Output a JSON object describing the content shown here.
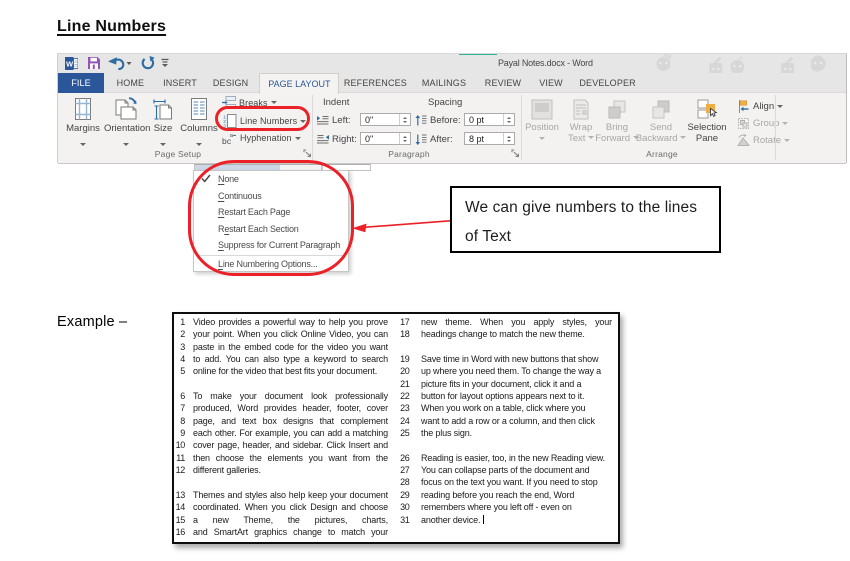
{
  "doc": {
    "heading": "Line Numbers",
    "example_label": "Example –"
  },
  "annotations": {
    "red_color": "#ec2027",
    "callout_text": "We can give numbers to the lines of Text"
  },
  "word": {
    "titlebar": {
      "title": "Payal Notes.docx - Word",
      "qat_icons": [
        "word-app-icon",
        "save-icon",
        "undo-icon",
        "repeat-icon",
        "customize-qat-icon"
      ]
    },
    "tabs": [
      {
        "label": "FILE",
        "kind": "file"
      },
      {
        "label": "HOME",
        "kind": ""
      },
      {
        "label": "INSERT",
        "kind": ""
      },
      {
        "label": "DESIGN",
        "kind": ""
      },
      {
        "label": "PAGE LAYOUT",
        "kind": "active"
      },
      {
        "label": "REFERENCES",
        "kind": ""
      },
      {
        "label": "MAILINGS",
        "kind": ""
      },
      {
        "label": "REVIEW",
        "kind": ""
      },
      {
        "label": "VIEW",
        "kind": ""
      },
      {
        "label": "DEVELOPER",
        "kind": ""
      }
    ],
    "ribbon": {
      "page_setup": {
        "label": "Page Setup",
        "margins": "Margins",
        "orientation": "Orientation",
        "size": "Size",
        "columns": "Columns",
        "breaks": "Breaks",
        "line_numbers": "Line Numbers",
        "hyphenation": "Hyphenation"
      },
      "paragraph": {
        "label": "Paragraph",
        "indent_header": "Indent",
        "spacing_header": "Spacing",
        "left_label": "Left:",
        "left_value": "0\"",
        "right_label": "Right:",
        "right_value": "0\"",
        "before_label": "Before:",
        "before_value": "0 pt",
        "after_label": "After:",
        "after_value": "8 pt"
      },
      "arrange": {
        "label": "Arrange",
        "position": "Position",
        "wrap1": "Wrap",
        "wrap2": "Text",
        "bring1": "Bring",
        "bring2": "Forward",
        "send1": "Send",
        "send2": "Backward",
        "sel1": "Selection",
        "sel2": "Pane",
        "align": "Align",
        "group": "Group",
        "rotate": "Rotate"
      }
    },
    "line_numbers_menu": [
      {
        "label": "None",
        "accel": 0,
        "checked": true
      },
      {
        "label": "Continuous",
        "accel": 0,
        "checked": false
      },
      {
        "label": "Restart Each Page",
        "accel": 0,
        "checked": false
      },
      {
        "label": "Restart Each Section",
        "accel": 1,
        "checked": false
      },
      {
        "label": "Suppress for Current Paragraph",
        "accel": 0,
        "checked": false
      },
      {
        "label": "Line Numbering Options...",
        "accel": 0,
        "checked": false,
        "last": true
      }
    ]
  },
  "example": {
    "left_column": [
      {
        "n": 1,
        "t": "Video provides a powerful way to help you prove",
        "j": 1
      },
      {
        "n": 2,
        "t": "your point. When you click Online Video, you can",
        "j": 1
      },
      {
        "n": 3,
        "t": "paste in the embed code for the video you want",
        "j": 1
      },
      {
        "n": 4,
        "t": "to add. You can also type a keyword to search",
        "j": 1
      },
      {
        "n": 5,
        "t": "online for the video that best fits your document.",
        "j": 0
      },
      {
        "gap": 1
      },
      {
        "n": 6,
        "t": "To make your document look professionally",
        "j": 1
      },
      {
        "n": 7,
        "t": "produced, Word provides header, footer, cover",
        "j": 1
      },
      {
        "n": 8,
        "t": "page, and text box designs that complement",
        "j": 1
      },
      {
        "n": 9,
        "t": "each other. For example, you can add a matching",
        "j": 1
      },
      {
        "n": 10,
        "t": "cover page, header, and sidebar. Click Insert and",
        "j": 1
      },
      {
        "n": 11,
        "t": "then choose the elements you want from the",
        "j": 1
      },
      {
        "n": 12,
        "t": "different galleries.",
        "j": 0
      },
      {
        "gap": 1
      },
      {
        "n": 13,
        "t": "Themes and styles also help keep your document",
        "j": 1
      },
      {
        "n": 14,
        "t": "coordinated. When you click Design and choose",
        "j": 1
      },
      {
        "n": 15,
        "t": "a new Theme, the pictures, charts,",
        "j": 1
      },
      {
        "n": 16,
        "t": "and SmartArt graphics change to match your",
        "j": 1
      }
    ],
    "right_column": [
      {
        "n": 17,
        "t": "new theme. When you apply styles, your",
        "j": 1
      },
      {
        "n": 18,
        "t": "headings change to match the new theme.",
        "j": 0
      },
      {
        "gap": 1
      },
      {
        "n": 19,
        "t": "Save time in Word with new buttons that show",
        "j": 0
      },
      {
        "n": 20,
        "t": "up where you need them. To change the way a",
        "j": 0
      },
      {
        "n": 21,
        "t": "picture fits in your document, click it and a",
        "j": 0
      },
      {
        "n": 22,
        "t": "button for layout options appears next to it.",
        "j": 0
      },
      {
        "n": 23,
        "t": "When you work on a table, click where you",
        "j": 0
      },
      {
        "n": 24,
        "t": "want to add a row or a column, and then click",
        "j": 0
      },
      {
        "n": 25,
        "t": "the plus sign.",
        "j": 0
      },
      {
        "gap": 1
      },
      {
        "n": 26,
        "t": "Reading is easier, too, in the new Reading view.",
        "j": 0
      },
      {
        "n": 27,
        "t": "You can collapse parts of the document and",
        "j": 0
      },
      {
        "n": 28,
        "t": "focus on the text you want. If you need to stop",
        "j": 0
      },
      {
        "n": 29,
        "t": "reading before you reach the end, Word",
        "j": 0
      },
      {
        "n": 30,
        "t": "remembers where you left off - even on",
        "j": 0
      },
      {
        "n": 31,
        "t": "another device.",
        "j": 0,
        "cursor": 1
      }
    ]
  }
}
